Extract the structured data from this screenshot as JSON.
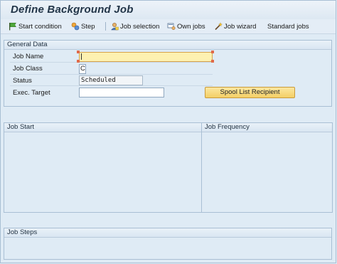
{
  "window": {
    "title": "Define Background Job"
  },
  "toolbar": {
    "start_condition": "Start condition",
    "step": "Step",
    "job_selection": "Job selection",
    "own_jobs": "Own jobs",
    "job_wizard": "Job wizard",
    "standard_jobs": "Standard jobs"
  },
  "general_data": {
    "title": "General Data",
    "job_name_label": "Job Name",
    "job_name_value": "",
    "job_class_label": "Job Class",
    "job_class_value": "C",
    "status_label": "Status",
    "status_value": "Scheduled",
    "exec_target_label": "Exec. Target",
    "exec_target_value": "",
    "spool_button": "Spool List Recipient"
  },
  "sections": {
    "job_start": "Job Start",
    "job_frequency": "Job Frequency",
    "job_steps": "Job Steps"
  },
  "icons": {
    "start_condition": "flag-icon",
    "step": "steps-icon",
    "job_selection": "job-selection-icon",
    "own_jobs": "own-jobs-icon",
    "job_wizard": "wizard-wand-icon"
  },
  "colors": {
    "background": "#dfebf5",
    "required_field": "#fdf1b1",
    "button_yellow": "#f4cf66"
  }
}
